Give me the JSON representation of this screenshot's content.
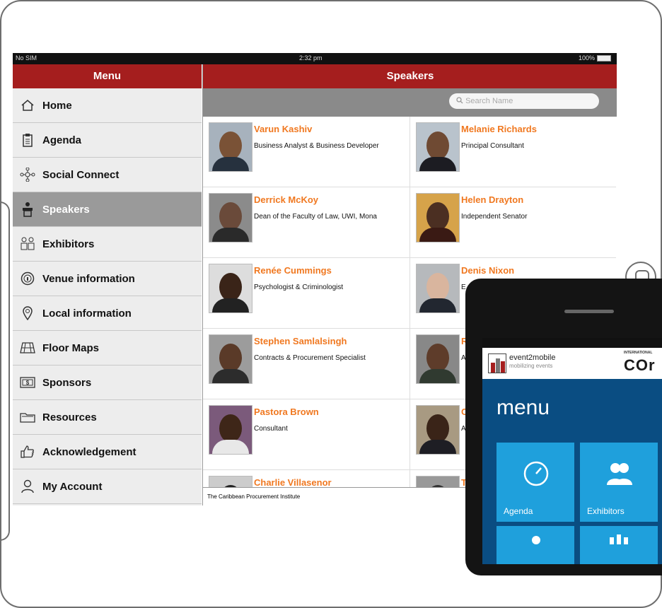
{
  "status_bar": {
    "carrier": "No SIM",
    "time": "2:32 pm",
    "battery": "100%"
  },
  "sidebar": {
    "title": "Menu",
    "items": [
      {
        "label": "Home",
        "icon": "home-icon"
      },
      {
        "label": "Agenda",
        "icon": "clipboard-icon"
      },
      {
        "label": "Social Connect",
        "icon": "network-icon"
      },
      {
        "label": "Speakers",
        "icon": "podium-icon",
        "active": true
      },
      {
        "label": "Exhibitors",
        "icon": "people-icon"
      },
      {
        "label": "Venue information",
        "icon": "info-icon"
      },
      {
        "label": "Local information",
        "icon": "map-pin-icon"
      },
      {
        "label": "Floor Maps",
        "icon": "floor-map-icon"
      },
      {
        "label": "Sponsors",
        "icon": "money-icon"
      },
      {
        "label": "Resources",
        "icon": "folder-icon"
      },
      {
        "label": "Acknowledgement",
        "icon": "thumbs-up-icon"
      },
      {
        "label": "My Account",
        "icon": "user-icon"
      }
    ]
  },
  "main": {
    "title": "Speakers",
    "search_placeholder": "Search Name",
    "speakers": [
      {
        "name": "Varun Kashiv",
        "title": "Business Analyst & Business Developer"
      },
      {
        "name": "Melanie Richards",
        "title": "Principal Consultant"
      },
      {
        "name": "Derrick McKoy",
        "title": "Dean of the Faculty of Law, UWI, Mona"
      },
      {
        "name": "Helen Drayton",
        "title": "Independent Senator"
      },
      {
        "name": "Renée Cummings",
        "title": "Psychologist & Criminologist"
      },
      {
        "name": "Denis Nixon",
        "title": "E"
      },
      {
        "name": "Stephen Samlalsingh",
        "title": "Contracts & Procurement Specialist"
      },
      {
        "name": "R",
        "title": "A"
      },
      {
        "name": "Pastora Brown",
        "title": "Consultant"
      },
      {
        "name": "C",
        "title": "A"
      },
      {
        "name": "Charlie Villasenor",
        "title": ""
      },
      {
        "name": "T",
        "title": ""
      }
    ],
    "footer": "The Caribbean Procurement Institute"
  },
  "phone": {
    "brand": "event2mobile",
    "tagline": "mobilizing events",
    "conference_tag": "INTERNATIONAL",
    "conference_word": "COr",
    "menu_title": "menu",
    "tiles": [
      {
        "label": "Agenda",
        "icon": "clock-icon"
      },
      {
        "label": "Exhibitors",
        "icon": "people-icon"
      }
    ]
  },
  "colors": {
    "header_red": "#a51e1e",
    "name_orange": "#f07820",
    "tile_blue": "#1fa0dc"
  }
}
